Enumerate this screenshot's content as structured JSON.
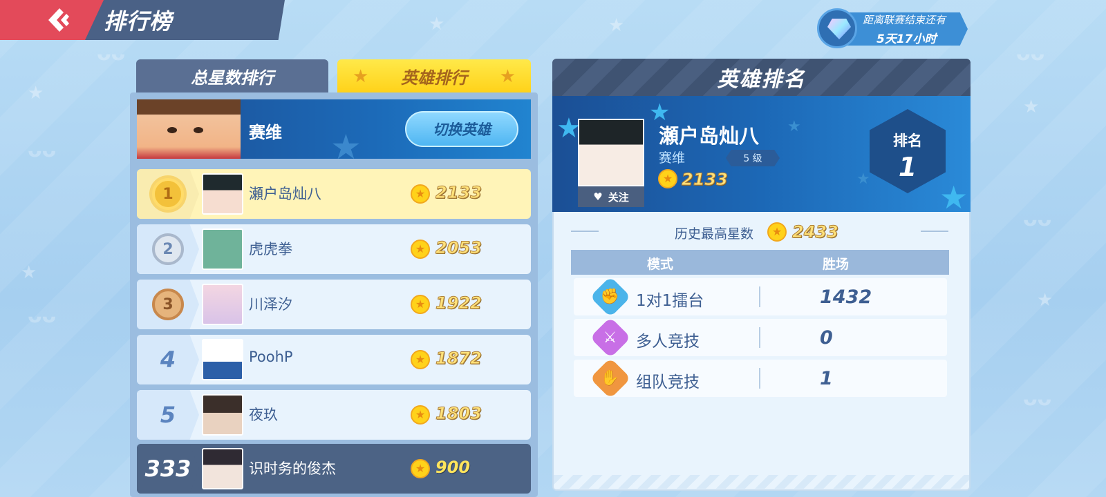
{
  "header": {
    "title": "排行榜"
  },
  "season_timer": {
    "line1": "距离联赛结束还有",
    "line2": "5天17小时"
  },
  "tabs": [
    {
      "label": "总星数排行",
      "active": false
    },
    {
      "label": "英雄排行",
      "active": true
    }
  ],
  "hero_selector": {
    "hero_name": "赛维",
    "switch_label": "切换英雄"
  },
  "rankings": [
    {
      "rank": "1",
      "name": "瀬户岛灿八",
      "stars": "2133"
    },
    {
      "rank": "2",
      "name": "虎虎拳",
      "stars": "2053"
    },
    {
      "rank": "3",
      "name": "川泽汐",
      "stars": "1922"
    },
    {
      "rank": "4",
      "name": "PoohP",
      "stars": "1872"
    },
    {
      "rank": "5",
      "name": "夜玖",
      "stars": "1803"
    }
  ],
  "self_row": {
    "rank": "333",
    "name": "识时务的俊杰",
    "stars": "900"
  },
  "detail": {
    "title": "英雄排名",
    "player_name": "瀬户岛灿八",
    "hero": "赛维",
    "level": "5 级",
    "stars": "2133",
    "follow_label": "关注",
    "rank_label": "排名",
    "rank_value": "1",
    "history_label": "历史最高星数",
    "history_stars": "2433",
    "table_headers": {
      "mode": "模式",
      "wins": "胜场"
    },
    "modes": [
      {
        "name": "1对1擂台",
        "wins": "1432",
        "icon": "boxing-glove-icon",
        "color": "#4bb4ea"
      },
      {
        "name": "多人竞技",
        "wins": "0",
        "icon": "crossed-swords-icon",
        "color": "#c86fe6"
      },
      {
        "name": "组队竞技",
        "wins": "1",
        "icon": "handshake-icon",
        "color": "#f0963f"
      }
    ]
  },
  "colors": {
    "back_button": "#e34a5a",
    "header_bar": "#4a6186",
    "active_tab": "#ffd21a",
    "accent_blue": "#3e5f92"
  }
}
